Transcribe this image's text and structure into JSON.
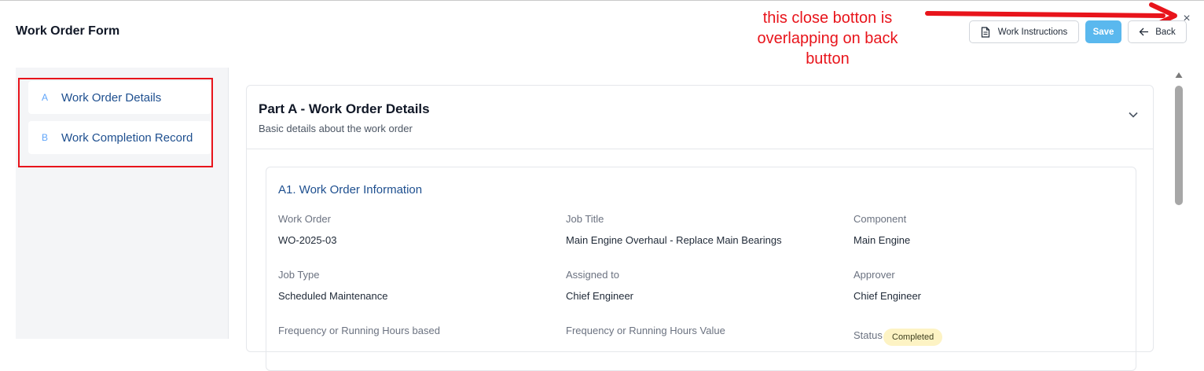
{
  "header": {
    "title": "Work Order Form",
    "work_instructions_label": "Work Instructions",
    "save_label": "Save",
    "back_label": "Back",
    "close_glyph": "×"
  },
  "annotation": {
    "line1": "this close botton is",
    "line2": "overlapping on back",
    "line3": "button",
    "color": "#e8141b"
  },
  "sidebar": {
    "items": [
      {
        "letter": "A",
        "label": "Work Order Details"
      },
      {
        "letter": "B",
        "label": "Work Completion Record"
      }
    ]
  },
  "section": {
    "title": "Part A - Work Order Details",
    "subtitle": "Basic details about the work order",
    "info_card": {
      "title": "A1. Work Order Information",
      "fields": [
        {
          "label": "Work Order",
          "value": "WO-2025-03"
        },
        {
          "label": "Job Title",
          "value": "Main Engine Overhaul - Replace Main Bearings"
        },
        {
          "label": "Component",
          "value": "Main Engine"
        },
        {
          "label": "Job Type",
          "value": "Scheduled Maintenance"
        },
        {
          "label": "Assigned to",
          "value": "Chief Engineer"
        },
        {
          "label": "Approver",
          "value": "Chief Engineer"
        },
        {
          "label": "Frequency or Running Hours based",
          "value": ""
        },
        {
          "label": "Frequency or Running Hours Value",
          "value": ""
        },
        {
          "label": "Status",
          "value": "Completed"
        }
      ]
    }
  },
  "colors": {
    "accent": "#5ab8ee",
    "link": "#1e4f8f",
    "status_badge": "#fdf3c4"
  }
}
